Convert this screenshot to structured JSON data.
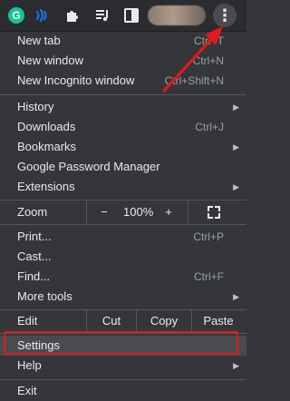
{
  "toolbar": {
    "grammarly_letter": "G",
    "icons": [
      "grammarly-icon",
      "wave-icon",
      "puzzle-icon",
      "playlist-icon",
      "side-panel-icon",
      "profile-avatar",
      "more-vert-icon"
    ],
    "more_icon_glyph": "⋮"
  },
  "menu": {
    "group1": [
      {
        "label": "New tab",
        "shortcut": "Ctrl+T"
      },
      {
        "label": "New window",
        "shortcut": "Ctrl+N"
      },
      {
        "label": "New Incognito window",
        "shortcut": "Ctrl+Shift+N"
      }
    ],
    "group2": [
      {
        "label": "History",
        "submenu": true
      },
      {
        "label": "Downloads",
        "shortcut": "Ctrl+J"
      },
      {
        "label": "Bookmarks",
        "submenu": true
      },
      {
        "label": "Google Password Manager"
      },
      {
        "label": "Extensions",
        "submenu": true
      }
    ],
    "zoom": {
      "label": "Zoom",
      "minus": "−",
      "value": "100%",
      "plus": "+"
    },
    "group3": [
      {
        "label": "Print...",
        "shortcut": "Ctrl+P"
      },
      {
        "label": "Cast..."
      },
      {
        "label": "Find...",
        "shortcut": "Ctrl+F"
      },
      {
        "label": "More tools",
        "submenu": true
      }
    ],
    "edit": {
      "label": "Edit",
      "cut": "Cut",
      "copy": "Copy",
      "paste": "Paste"
    },
    "group4": [
      {
        "label": "Settings"
      },
      {
        "label": "Help",
        "submenu": true
      }
    ],
    "exit": {
      "label": "Exit"
    }
  },
  "colors": {
    "menu_bg": "#35363a",
    "toolbar_bg": "#2b2c30",
    "highlight_box": "#e1191d",
    "grammarly": "#15c39a",
    "wave": "#1a73e8"
  }
}
